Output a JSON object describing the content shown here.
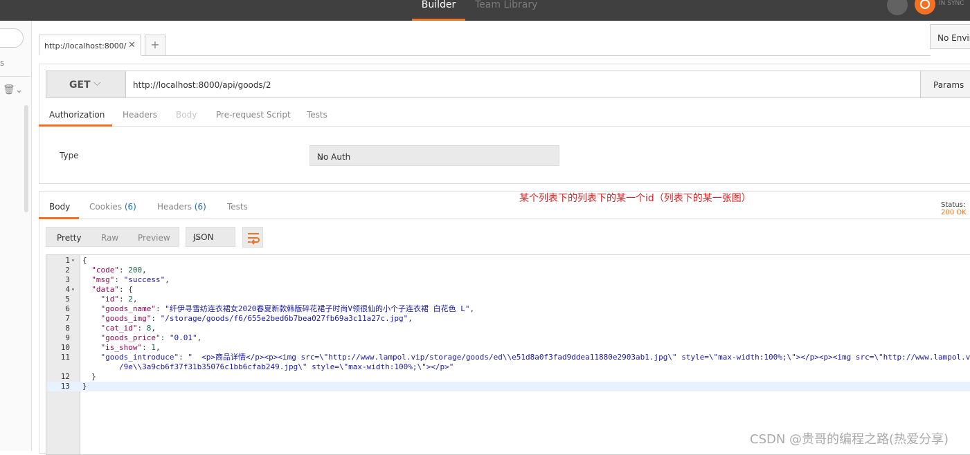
{
  "topbar": {
    "builder_tab": "Builder",
    "team_tab": "Team Library",
    "sync_text": "IN SYNC"
  },
  "sidebar": {
    "partial_text": "s"
  },
  "request_tab": {
    "label": "http://localhost:8000/",
    "close": "✕",
    "add": "+"
  },
  "environment": {
    "label": "No Environment"
  },
  "request": {
    "method": "GET",
    "url": "http://localhost:8000/api/goods/2",
    "params_label": "Params"
  },
  "request_tabs": [
    "Authorization",
    "Headers",
    "Body",
    "Pre-request Script",
    "Tests"
  ],
  "auth": {
    "type_label": "Type",
    "value": "No Auth"
  },
  "response_tabs": {
    "body": "Body",
    "cookies": "Cookies",
    "cookies_count": "(6)",
    "headers": "Headers",
    "headers_count": "(6)",
    "tests": "Tests"
  },
  "annotation": "某个列表下的列表下的某一个id（列表下的某一张图）",
  "status": {
    "label": "Status:",
    "value": "200 OK"
  },
  "view": {
    "pretty": "Pretty",
    "raw": "Raw",
    "preview": "Preview",
    "format": "JSON"
  },
  "code": {
    "line_numbers": [
      "1",
      "2",
      "3",
      "4",
      "5",
      "6",
      "7",
      "8",
      "9",
      "10",
      "11",
      "",
      "12",
      "13"
    ],
    "lines": [
      "{",
      "  \"code\": 200,",
      "  \"msg\": \"success\",",
      "  \"data\": {",
      "    \"id\": 2,",
      "    \"goods_name\": \"纤伊寻雪纺连衣裙女2020春夏新款韩版碎花裙子时尚V领很仙的小个子连衣裙 白花色 L\",",
      "    \"goods_img\": \"/storage/goods/f6/655e2bed6b7bea027fb69a3c11a27c.jpg\",",
      "    \"cat_id\": 8,",
      "    \"goods_price\": \"0.01\",",
      "    \"is_show\": 1,",
      "    \"goods_introduce\": \"  <p>商品详情</p><p><img src=\\\"http://www.lampol.vip/storage/goods/ed\\\\e51d8a0f3fad9ddea11880e2903ab1.jpg\\\" style=\\\"max-width:100%;\\\"></p><p><img src=\\\"http://www.lampol.v",
      "        /9e\\\\3a9cb6f37f31b35076c1bb6cfab249.jpg\\\" style=\\\"max-width:100%;\\\"></p>\"",
      "  }",
      "}"
    ]
  },
  "watermark": "CSDN @贵哥的编程之路(热爱分享)",
  "colors": {
    "accent": "#f47023",
    "topbar": "#404040",
    "annotation": "#e02020"
  }
}
